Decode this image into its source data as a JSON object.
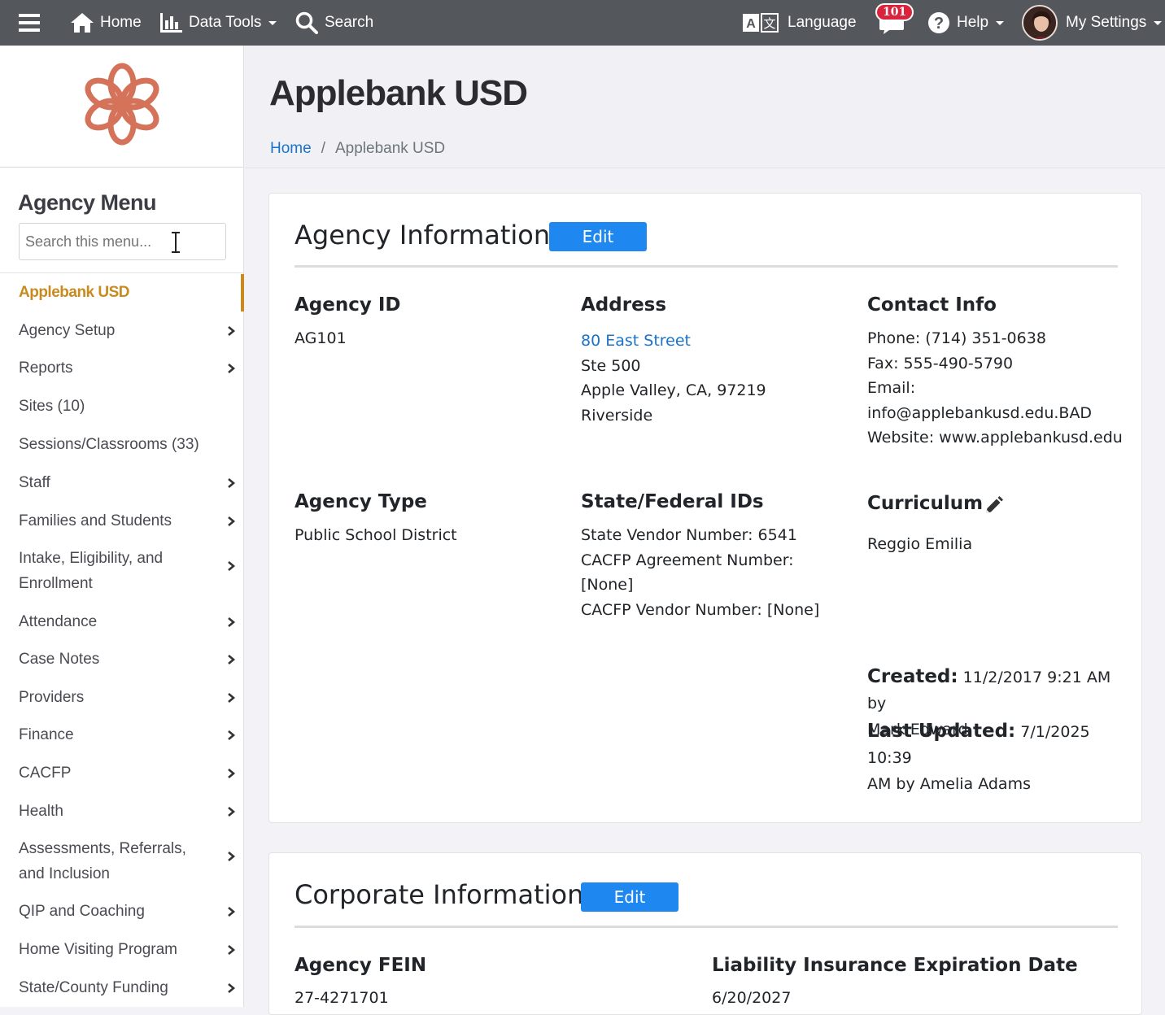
{
  "topbar": {
    "home_label": "Home",
    "data_tools_label": "Data Tools",
    "search_label": "Search",
    "language_label": "Language",
    "notifications_count": "101",
    "help_label": "Help",
    "settings_label": "My Settings"
  },
  "sidebar": {
    "menu_title": "Agency Menu",
    "search_placeholder": "Search this menu...",
    "active_item": "Applebank USD",
    "items": [
      {
        "label": "Agency Setup"
      },
      {
        "label": "Reports"
      },
      {
        "label": "Sites (10)"
      },
      {
        "label": "Sessions/Classrooms (33)"
      },
      {
        "label": "Staff"
      },
      {
        "label": "Families and Students"
      },
      {
        "label": "Intake, Eligibility, and Enrollment"
      },
      {
        "label": "Attendance"
      },
      {
        "label": "Case Notes"
      },
      {
        "label": "Providers"
      },
      {
        "label": "Finance"
      },
      {
        "label": "CACFP"
      },
      {
        "label": "Health"
      },
      {
        "label": "Assessments, Referrals, and Inclusion"
      },
      {
        "label": "QIP and Coaching"
      },
      {
        "label": "Home Visiting Program"
      },
      {
        "label": "State/County Funding"
      }
    ]
  },
  "header": {
    "title": "Applebank USD",
    "breadcrumb_home": "Home",
    "breadcrumb_sep": "/",
    "breadcrumb_current": "Applebank USD"
  },
  "agency_info": {
    "title": "Agency Information",
    "edit_label": "Edit",
    "agency_id_label": "Agency ID",
    "agency_id": "AG101",
    "address_label": "Address",
    "address_street": "80 East Street",
    "address_line2": "Ste 500",
    "address_city": "Apple Valley, CA, 97219",
    "address_county": "Riverside",
    "contact_label": "Contact Info",
    "phone": "Phone: (714) 351-0638",
    "fax": "Fax: 555-490-5790",
    "email_label": "Email:",
    "email": "info@applebankusd.edu.BAD",
    "website": "Website: www.applebankusd.edu",
    "agency_type_label": "Agency Type",
    "agency_type": "Public School District",
    "ids_label": "State/Federal IDs",
    "state_vendor": "State Vendor Number: 6541",
    "cacfp_agreement_label": "CACFP Agreement Number:",
    "cacfp_agreement": "[None]",
    "cacfp_vendor": "CACFP Vendor Number: [None]",
    "curriculum_label": "Curriculum",
    "curriculum": "Reggio Emilia",
    "created_label": "Created:",
    "created_value": "11/2/2017 9:21 AM by",
    "created_by": "Mark Edward",
    "updated_label": "Last Updated:",
    "updated_value": "7/1/2025 10:39",
    "updated_by": "AM by Amelia Adams"
  },
  "corporate_info": {
    "title": "Corporate Information",
    "edit_label": "Edit",
    "fein_label": "Agency FEIN",
    "fein": "27-4271701",
    "insurance_label": "Liability Insurance Expiration Date",
    "insurance_date": "6/20/2027"
  },
  "colors": {
    "topbar": "#54575c",
    "accent": "#c98a1e",
    "link": "#1a73c9",
    "button": "#1e88f0",
    "logo": "#d4735a",
    "badge": "#d9243c"
  }
}
